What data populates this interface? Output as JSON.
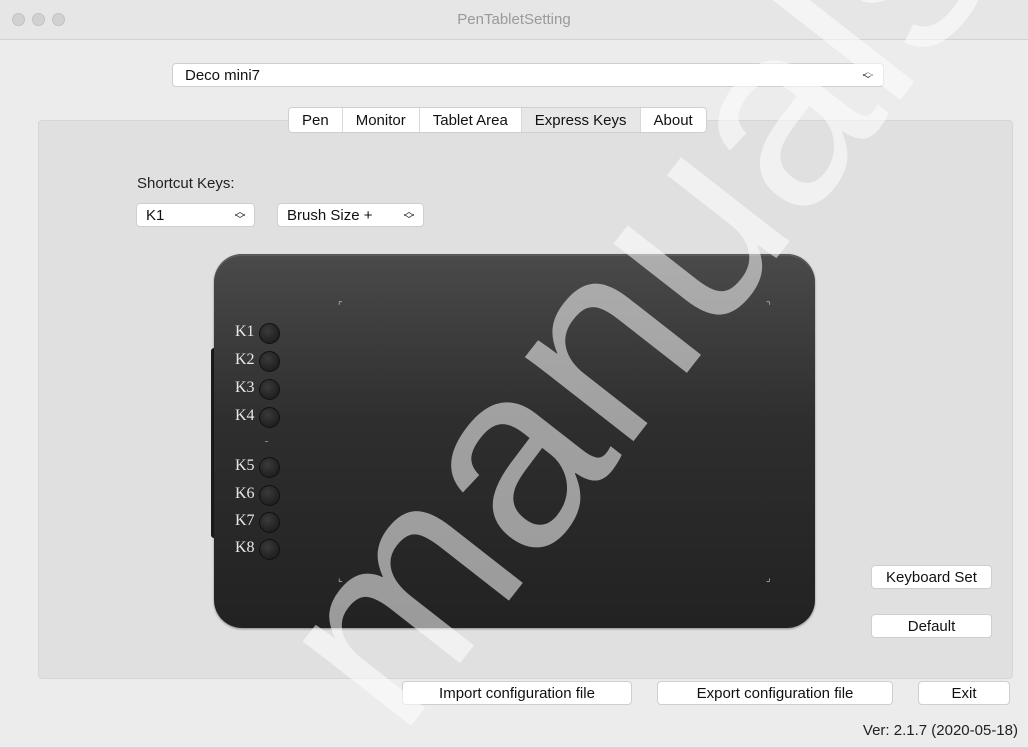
{
  "window": {
    "title": "PenTabletSetting"
  },
  "device": {
    "selected": "Deco mini7"
  },
  "tabs": [
    {
      "label": "Pen"
    },
    {
      "label": "Monitor"
    },
    {
      "label": "Tablet Area"
    },
    {
      "label": "Express Keys",
      "active": true
    },
    {
      "label": "About"
    }
  ],
  "shortcut": {
    "label": "Shortcut Keys:",
    "key_selected": "K1",
    "action_selected": "Brush Size +"
  },
  "keys": [
    {
      "label": "K1"
    },
    {
      "label": "K2"
    },
    {
      "label": "K3"
    },
    {
      "label": "K4"
    },
    {
      "label": "K5"
    },
    {
      "label": "K6"
    },
    {
      "label": "K7"
    },
    {
      "label": "K8"
    }
  ],
  "buttons": {
    "keyboard_set": "Keyboard Set",
    "default": "Default",
    "import": "Import configuration file",
    "export": "Export configuration file",
    "exit": "Exit"
  },
  "version": "Ver: 2.1.7 (2020-05-18)",
  "watermark": "manualsoft"
}
